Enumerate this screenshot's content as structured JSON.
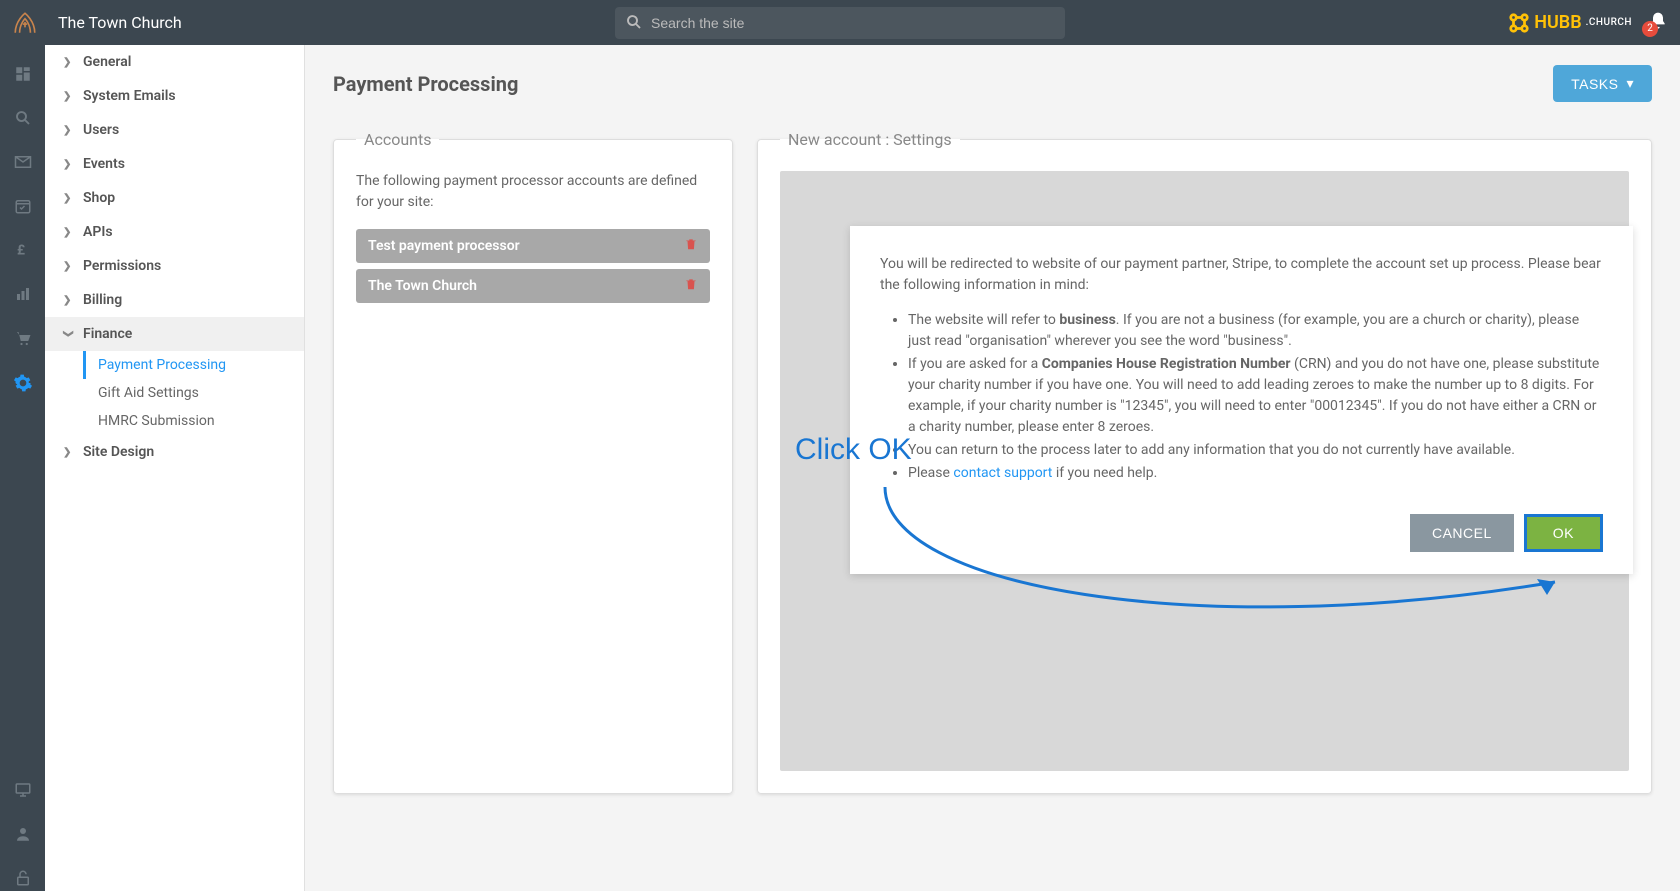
{
  "header": {
    "site_name": "The Town Church",
    "search_placeholder": "Search the site",
    "brand": "HUBB",
    "brand_sub": ".CHURCH",
    "notification_count": "2"
  },
  "sidenav": {
    "items": [
      {
        "label": "General"
      },
      {
        "label": "System Emails"
      },
      {
        "label": "Users"
      },
      {
        "label": "Events"
      },
      {
        "label": "Shop"
      },
      {
        "label": "APIs"
      },
      {
        "label": "Permissions"
      },
      {
        "label": "Billing"
      },
      {
        "label": "Finance"
      },
      {
        "label": "Site Design"
      }
    ],
    "finance_sub": [
      {
        "label": "Payment Processing"
      },
      {
        "label": "Gift Aid Settings"
      },
      {
        "label": "HMRC Submission"
      }
    ]
  },
  "page": {
    "title": "Payment Processing",
    "tasks_btn": "TASKS"
  },
  "accounts_panel": {
    "legend": "Accounts",
    "description": "The following payment processor accounts are defined for your site:",
    "rows": [
      {
        "name": "Test payment processor"
      },
      {
        "name": "The Town Church"
      }
    ]
  },
  "settings_panel": {
    "legend": "New account : Settings"
  },
  "modal": {
    "intro": "You will be redirected to website of our payment partner, Stripe, to complete the account set up process. Please bear the following information in mind:",
    "b1_pre": "The website will refer to ",
    "b1_bold": "business",
    "b1_post": ". If you are not a business (for example, you are a church or charity), please just read \"organisation\" wherever you see the word \"business\".",
    "b2_pre": "If you are asked for a ",
    "b2_bold": "Companies House Registration Number",
    "b2_post": " (CRN) and you do not have one, please substitute your charity number if you have one. You will need to add leading zeroes to make the number up to 8 digits. For example, if your charity number is \"12345\", you will need to enter \"00012345\". If you do not have either a CRN or a charity number, please enter 8 zeroes.",
    "b3": "You can return to the process later to add any information that you do not currently have available.",
    "b4_pre": "Please ",
    "b4_link": "contact support",
    "b4_post": " if you need help.",
    "cancel": "CANCEL",
    "ok": "OK"
  },
  "annotation": {
    "text": "Click OK"
  }
}
